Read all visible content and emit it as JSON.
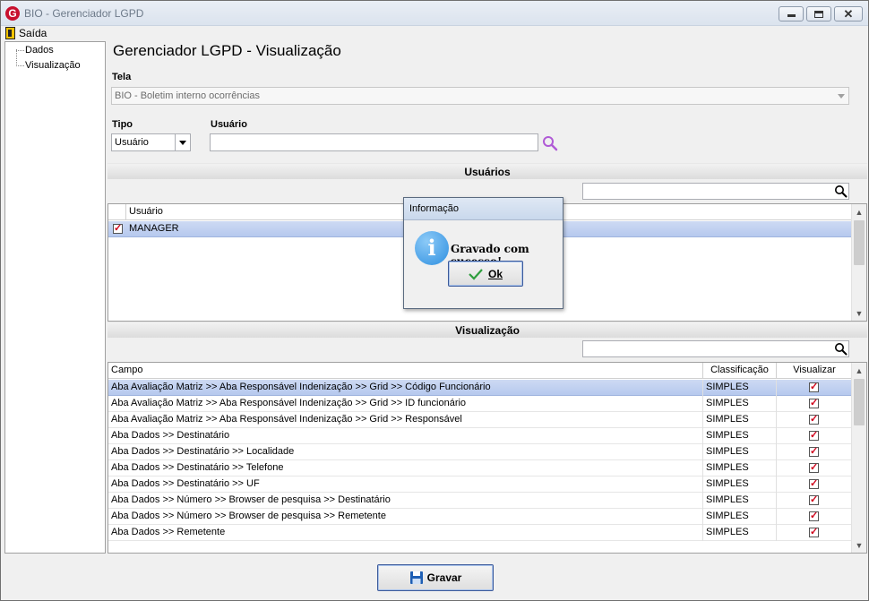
{
  "window": {
    "title": "BIO - Gerenciador LGPD"
  },
  "menu": {
    "exit_label": "Saída"
  },
  "tree": {
    "items": [
      "Dados",
      "Visualização"
    ]
  },
  "page": {
    "title": "Gerenciador LGPD - Visualização"
  },
  "form": {
    "tela_label": "Tela",
    "tela_value": "BIO - Boletim interno ocorrências",
    "tipo_label": "Tipo",
    "tipo_value": "Usuário",
    "usuario_label": "Usuário",
    "usuario_value": ""
  },
  "users_section": {
    "title": "Usuários",
    "search_value": "",
    "column": "Usuário",
    "rows": [
      {
        "name": "MANAGER",
        "checked": true
      }
    ]
  },
  "visual_section": {
    "title": "Visualização",
    "search_value": "",
    "columns": [
      "Campo",
      "Classificação",
      "Visualizar"
    ],
    "rows": [
      {
        "campo": "Aba Avaliação Matriz >> Aba Responsável Indenização >> Grid >> Código Funcionário",
        "classificacao": "SIMPLES",
        "visualizar": true
      },
      {
        "campo": "Aba Avaliação Matriz >> Aba Responsável Indenização >> Grid >> ID funcionário",
        "classificacao": "SIMPLES",
        "visualizar": true
      },
      {
        "campo": "Aba Avaliação Matriz >> Aba Responsável Indenização >> Grid >> Responsável",
        "classificacao": "SIMPLES",
        "visualizar": true
      },
      {
        "campo": "Aba Dados >> Destinatário",
        "classificacao": "SIMPLES",
        "visualizar": true
      },
      {
        "campo": "Aba Dados >> Destinatário >> Localidade",
        "classificacao": "SIMPLES",
        "visualizar": true
      },
      {
        "campo": "Aba Dados >> Destinatário >> Telefone",
        "classificacao": "SIMPLES",
        "visualizar": true
      },
      {
        "campo": "Aba Dados >> Destinatário >> UF",
        "classificacao": "SIMPLES",
        "visualizar": true
      },
      {
        "campo": "Aba Dados >> Número >> Browser de pesquisa >> Destinatário",
        "classificacao": "SIMPLES",
        "visualizar": true
      },
      {
        "campo": "Aba Dados >> Número >> Browser de pesquisa >> Remetente",
        "classificacao": "SIMPLES",
        "visualizar": true
      },
      {
        "campo": "Aba Dados >> Remetente",
        "classificacao": "SIMPLES",
        "visualizar": true
      }
    ]
  },
  "buttons": {
    "save_label": "Gravar"
  },
  "dialog": {
    "title": "Informação",
    "message": "Gravado com sucesso!",
    "ok_label": "Ok"
  },
  "icons": {
    "app": "app-logo-icon",
    "exit": "exit-door-icon",
    "search": "magnifier-icon",
    "info": "info-icon",
    "check": "checkmark-icon",
    "save": "floppy-disk-icon"
  },
  "colors": {
    "selected_row": "#b6c9ee",
    "check_mark": "#d0021b",
    "search_user_icon": "#b05ad6",
    "ok_check": "#2e9e3e"
  }
}
